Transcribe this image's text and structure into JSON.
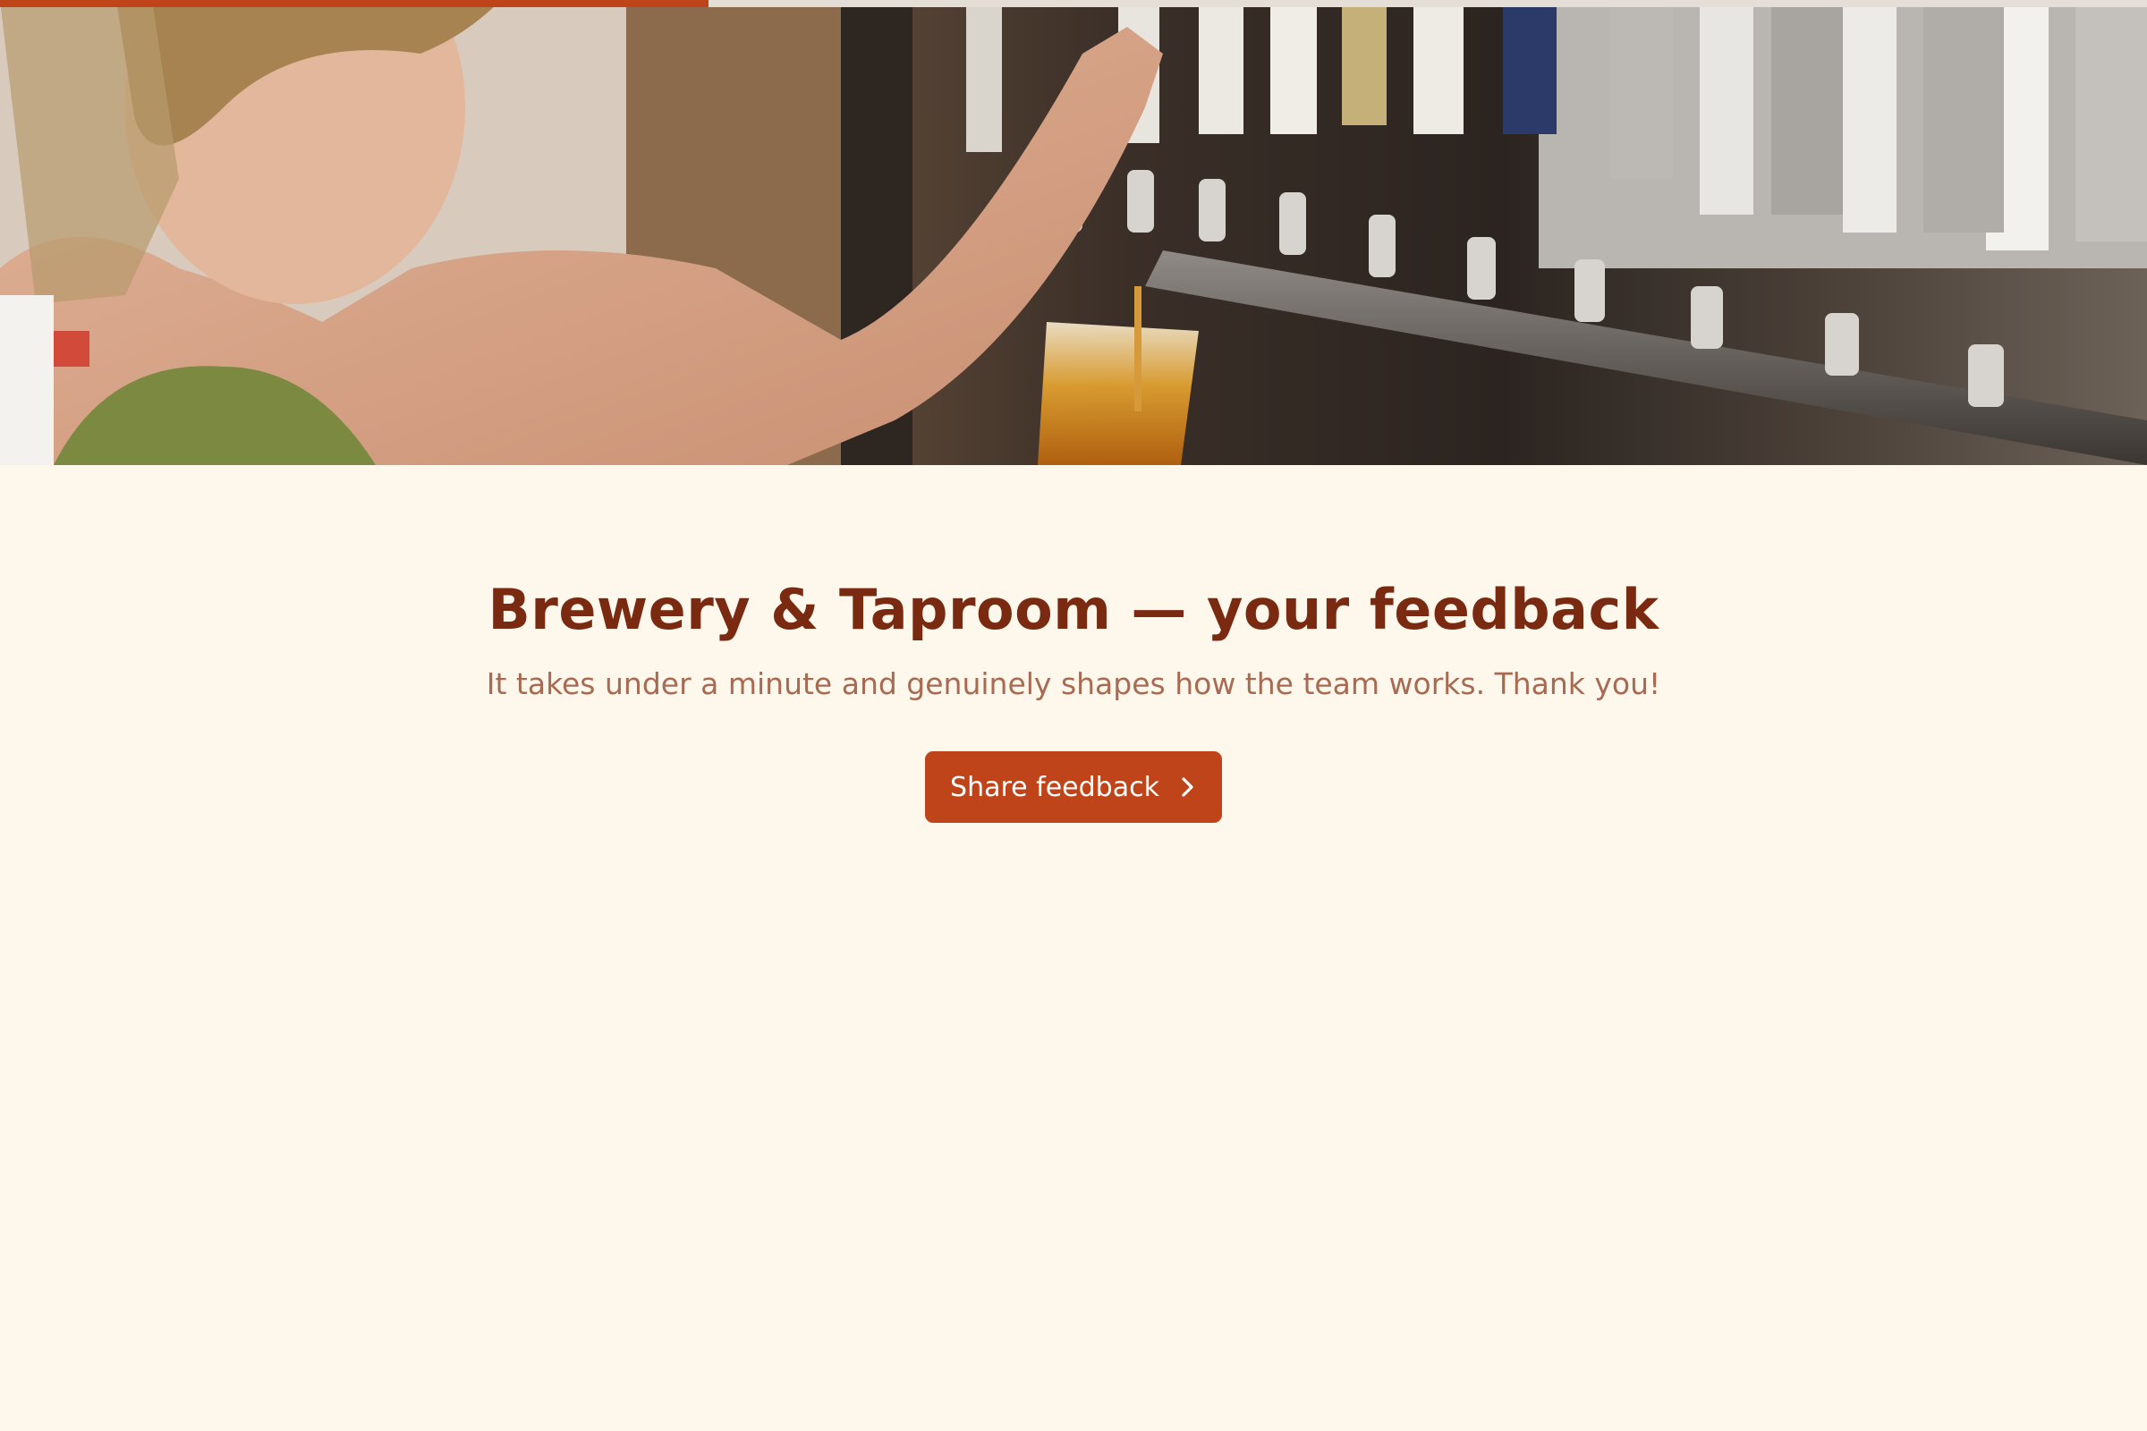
{
  "progress": {
    "fraction": 0.33,
    "fill_color": "#C0441A",
    "track_color": "#E4DED6"
  },
  "hero": {
    "image": "bartender-pouring-beer-from-tap-photo"
  },
  "intro": {
    "title": "Brewery & Taproom — your feedback",
    "subtitle": "It takes under a minute and genuinely shapes how the team works. Thank you!",
    "cta_label": "Share feedback",
    "cta_icon": "chevron-right-icon"
  },
  "colors": {
    "background": "#FEF7EB",
    "title": "#7A2A10",
    "subtitle": "#A86A52",
    "accent": "#C0441A"
  }
}
